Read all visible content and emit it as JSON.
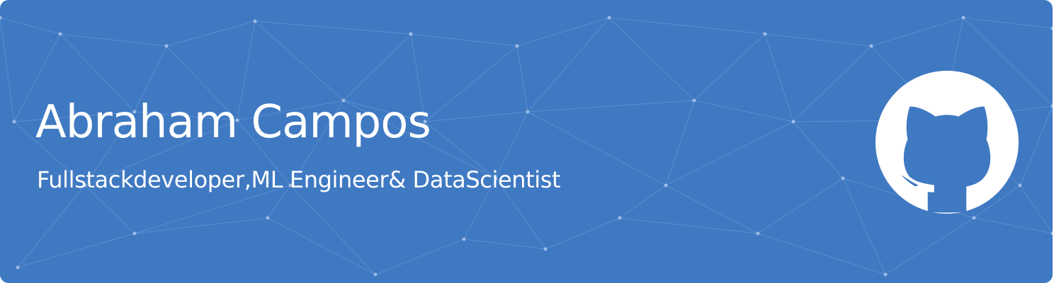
{
  "profile": {
    "name": "Abraham Campos",
    "tagline": "Fullstackdeveloper,ML Engineer& DataScientist"
  },
  "brand": {
    "logo_icon": "github-icon"
  },
  "colors": {
    "background": "#3f79c2",
    "mesh_line": "#7ea6dc",
    "mesh_node": "#b7cff0",
    "text": "#ffffff",
    "logo": "#ffffff"
  }
}
